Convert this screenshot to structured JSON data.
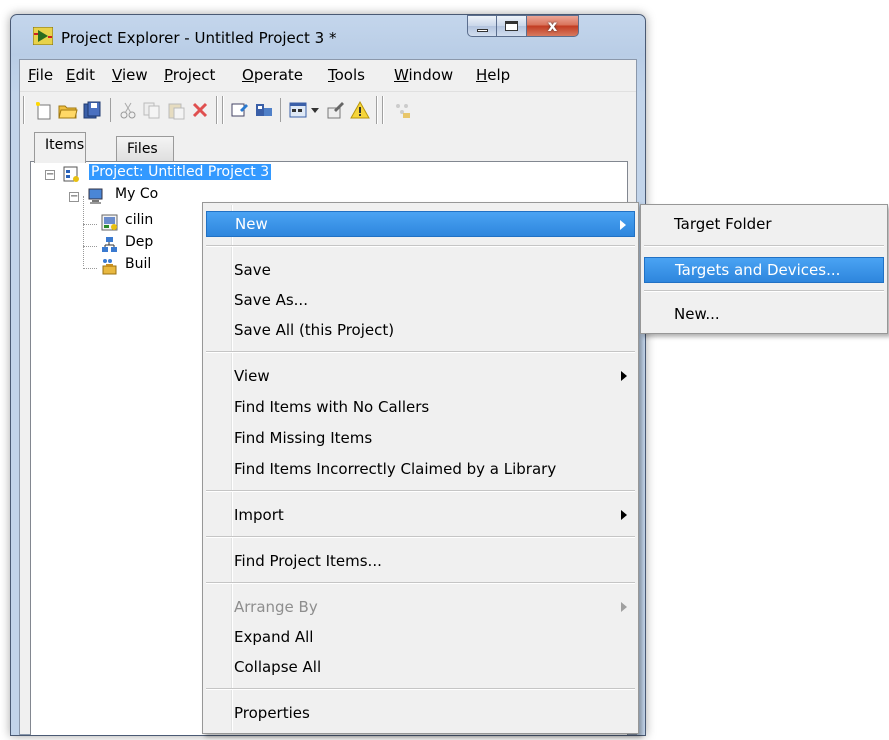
{
  "window": {
    "title": "Project Explorer - Untitled Project 3 *",
    "close_glyph": "x"
  },
  "menubar": [
    "File",
    "Edit",
    "View",
    "Project",
    "Operate",
    "Tools",
    "Window",
    "Help"
  ],
  "toolbar_icons": [
    "new-icon",
    "open-icon",
    "save-all-icon",
    "cut-icon",
    "copy-icon",
    "paste-icon",
    "delete-icon",
    "build-icon",
    "deploy-icon",
    "view-icon",
    "dropdown-icon",
    "tools-icon",
    "warning-icon",
    "more-icon"
  ],
  "tabs": {
    "items": "Items",
    "files": "Files"
  },
  "tree": {
    "project": "Project: Untitled Project 3",
    "my_computer": "My Co",
    "vi": "cilin",
    "dependencies": "Dep",
    "build_specs": "Buil"
  },
  "context_menu": {
    "new": "New",
    "save": "Save",
    "save_as": "Save As...",
    "save_all": "Save All (this Project)",
    "view": "View",
    "find_no_callers": "Find Items with No Callers",
    "find_missing": "Find Missing Items",
    "find_incorrect": "Find Items Incorrectly Claimed by a Library",
    "import": "Import",
    "find_project_items": "Find Project Items...",
    "arrange_by": "Arrange By",
    "expand_all": "Expand All",
    "collapse_all": "Collapse All",
    "properties": "Properties"
  },
  "submenu": {
    "target_folder": "Target Folder",
    "targets_devices": "Targets and Devices...",
    "new": "New..."
  },
  "colors": {
    "highlight": "#3399ff",
    "menu_bg": "#f0f0f0",
    "title_gradient": "#c4d6ec"
  }
}
